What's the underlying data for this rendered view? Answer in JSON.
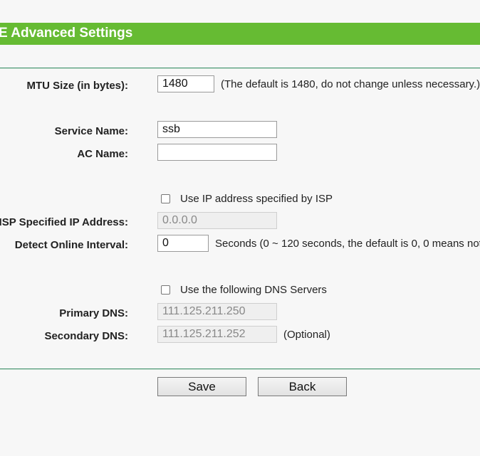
{
  "header": {
    "title": "E Advanced Settings"
  },
  "mtu": {
    "label": "MTU Size (in bytes):",
    "value": "1480",
    "note": "(The default is 1480, do not change unless necessary.)"
  },
  "service_name": {
    "label": "Service Name:",
    "value": "ssb"
  },
  "ac_name": {
    "label": "AC Name:",
    "value": ""
  },
  "use_isp_ip": {
    "label": "Use IP address specified by ISP",
    "checked": false
  },
  "isp_ip": {
    "label": "ISP Specified IP Address:",
    "value": "0.0.0.0"
  },
  "detect_interval": {
    "label": "Detect Online Interval:",
    "value": "0",
    "note": "Seconds (0 ~ 120 seconds, the default is 0, 0 means not"
  },
  "use_dns": {
    "label": "Use the following DNS Servers",
    "checked": false
  },
  "primary_dns": {
    "label": "Primary DNS:",
    "value": "111.125.211.250"
  },
  "secondary_dns": {
    "label": "Secondary DNS:",
    "value": "111.125.211.252",
    "note": "(Optional)"
  },
  "buttons": {
    "save": "Save",
    "back": "Back"
  },
  "colors": {
    "header_bg": "#66bb33",
    "divider": "#3f8f6a"
  }
}
